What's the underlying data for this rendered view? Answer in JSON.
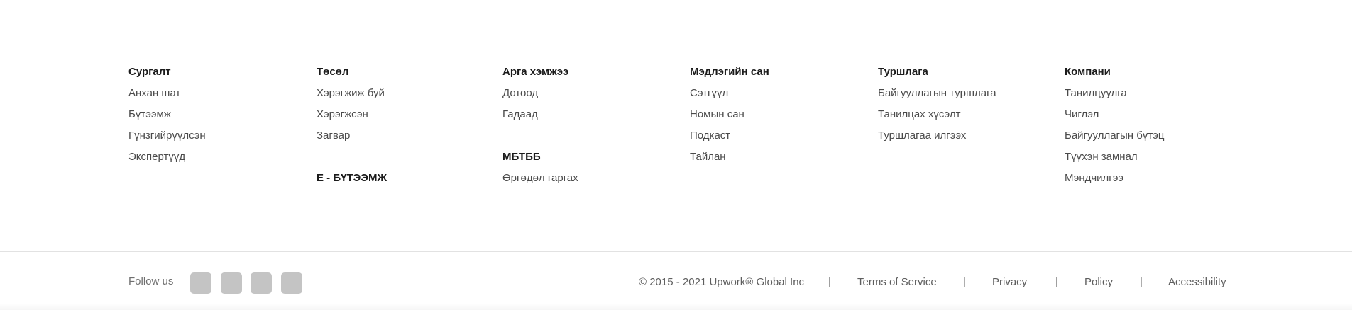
{
  "columns": [
    {
      "heading": "Сургалт",
      "links": [
        "Анхан шат",
        "Бүтээмж",
        "Гүнзгийрүүлсэн",
        "Экспертүүд"
      ]
    },
    {
      "heading": "Төсөл",
      "links": [
        "Хэрэгжиж буй",
        "Хэрэгжсэн",
        "Загвар"
      ],
      "subheading": "Е - БҮТЭЭМЖ"
    },
    {
      "heading": "Арга хэмжээ",
      "links": [
        "Дотоод",
        "Гадаад"
      ],
      "subheading": "МБТББ",
      "sublinks": [
        "Өргөдөл гаргах"
      ]
    },
    {
      "heading": "Мэдлэгийн сан",
      "links": [
        "Сэтгүүл",
        "Номын сан",
        "Подкаст",
        "Тайлан"
      ]
    },
    {
      "heading": "Туршлага",
      "links": [
        "Байгууллагын туршлага",
        "Танилцах хүсэлт",
        "Туршлагаа илгээх"
      ]
    },
    {
      "heading": "Компани",
      "links": [
        "Танилцуулга",
        "Чиглэл",
        "Байгууллагын бүтэц",
        "Түүхэн замнал",
        "Мэндчилгээ"
      ]
    }
  ],
  "bottom": {
    "follow_label": "Follow us",
    "social_icons": [
      "social-icon-1",
      "social-icon-2",
      "social-icon-3",
      "social-icon-4"
    ],
    "copyright": "© 2015 - 2021 Upwork® Global Inc",
    "separator": "|",
    "links": [
      "Terms of Service",
      "Privacy",
      "Policy",
      "Accessibility"
    ]
  },
  "colors": {
    "heading": "#1b1b1b",
    "link": "#4a4a4a",
    "muted": "#6f6f6f",
    "icon_placeholder": "#c4c4c4",
    "divider": "#e2e2e2"
  }
}
